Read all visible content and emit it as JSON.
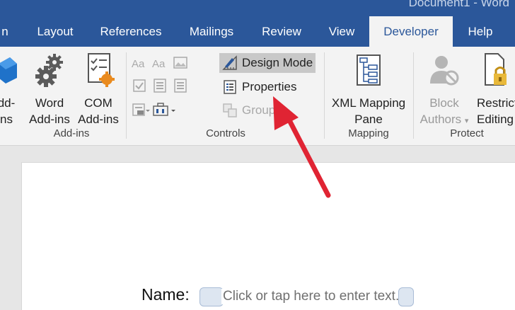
{
  "window": {
    "title": "Document1 - Word"
  },
  "tabs": [
    {
      "label": "n"
    },
    {
      "label": "Layout"
    },
    {
      "label": "References"
    },
    {
      "label": "Mailings"
    },
    {
      "label": "Review"
    },
    {
      "label": "View"
    },
    {
      "label": "Developer",
      "active": true
    },
    {
      "label": "Help"
    }
  ],
  "ribbon": {
    "addins": {
      "label": "Add-ins",
      "addins_button": {
        "line1": "dd-",
        "line2": "ns"
      },
      "word_addins": {
        "line1": "Word",
        "line2": "Add-ins"
      },
      "com_addins": {
        "line1": "COM",
        "line2": "Add-ins"
      }
    },
    "controls": {
      "label": "Controls",
      "design_mode": "Design Mode",
      "properties": "Properties",
      "group": "Group"
    },
    "mapping": {
      "label": "Mapping",
      "xml_mapping": {
        "line1": "XML Mapping",
        "line2": "Pane"
      }
    },
    "protect": {
      "label": "Protect",
      "block_authors": {
        "line1": "Block",
        "line2": "Authors"
      },
      "restrict_editing": {
        "line1": "Restrict",
        "line2": "Editing"
      }
    }
  },
  "document": {
    "name_label": "Name:",
    "content_control_placeholder": "Click or tap here to enter text."
  },
  "colors": {
    "title_bar": "#2b579a",
    "ribbon": "#f3f3f3",
    "annotation_arrow": "#e02433"
  }
}
